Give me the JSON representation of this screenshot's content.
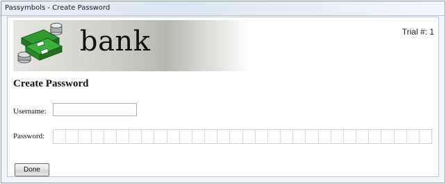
{
  "window": {
    "title": "Passymbols - Create Password"
  },
  "banner": {
    "icon": "money-stack-icon",
    "text": "bank"
  },
  "trial": {
    "label": "Trial #: 1"
  },
  "form": {
    "heading": "Create Password",
    "username_label": "Username:",
    "username_value": "",
    "password_label": "Password:",
    "password_slots": 30,
    "done_label": "Done"
  }
}
